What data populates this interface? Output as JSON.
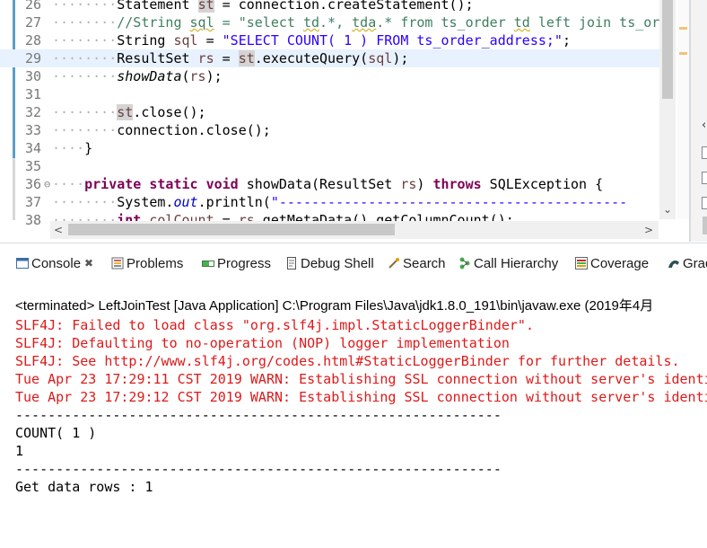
{
  "editor": {
    "lines": [
      {
        "num": "26",
        "fold": "",
        "indent": "········",
        "tokens": [
          {
            "t": "Statement "
          },
          {
            "t": "st",
            "c": "var occ"
          },
          {
            "t": " = connection.createStatement();"
          }
        ]
      },
      {
        "num": "27",
        "fold": "",
        "indent": "········",
        "tokens": [
          {
            "t": "//String ",
            "c": "cmt"
          },
          {
            "t": "sql",
            "c": "cmt squig"
          },
          {
            "t": " = \"select ",
            "c": "cmt"
          },
          {
            "t": "td",
            "c": "cmt squig"
          },
          {
            "t": ".*, ",
            "c": "cmt"
          },
          {
            "t": "tda",
            "c": "cmt squig"
          },
          {
            "t": ".* from ts_order ",
            "c": "cmt"
          },
          {
            "t": "td",
            "c": "cmt squig"
          },
          {
            "t": " left join ts_ord",
            "c": "cmt"
          }
        ]
      },
      {
        "num": "28",
        "fold": "",
        "indent": "········",
        "tokens": [
          {
            "t": "String "
          },
          {
            "t": "sql",
            "c": "var"
          },
          {
            "t": " = "
          },
          {
            "t": "\"SELECT COUNT( 1 ) FROM ts_order_address;\"",
            "c": "str"
          },
          {
            "t": ";"
          }
        ]
      },
      {
        "num": "29",
        "fold": "",
        "indent": "········",
        "current": true,
        "tokens": [
          {
            "t": "ResultSet "
          },
          {
            "t": "rs",
            "c": "var"
          },
          {
            "t": " = "
          },
          {
            "t": "st",
            "c": "var occ"
          },
          {
            "t": ".executeQuery("
          },
          {
            "t": "sql",
            "c": "var"
          },
          {
            "t": ");"
          }
        ]
      },
      {
        "num": "30",
        "fold": "",
        "indent": "········",
        "tokens": [
          {
            "t": "showData",
            "c": "it"
          },
          {
            "t": "("
          },
          {
            "t": "rs",
            "c": "var"
          },
          {
            "t": ");"
          }
        ]
      },
      {
        "num": "31",
        "fold": "",
        "indent": "",
        "tokens": []
      },
      {
        "num": "32",
        "fold": "",
        "indent": "········",
        "tokens": [
          {
            "t": "st",
            "c": "var occ"
          },
          {
            "t": ".close();"
          }
        ]
      },
      {
        "num": "33",
        "fold": "",
        "indent": "········",
        "tokens": [
          {
            "t": "connection.close();"
          }
        ]
      },
      {
        "num": "34",
        "fold": "",
        "indent": "····",
        "tokens": [
          {
            "t": "}"
          }
        ]
      },
      {
        "num": "35",
        "fold": "",
        "indent": "",
        "tokens": []
      },
      {
        "num": "36",
        "fold": "⊖",
        "indent": "····",
        "tokens": [
          {
            "t": "private static void",
            "c": "kw"
          },
          {
            "t": " showData(ResultSet "
          },
          {
            "t": "rs",
            "c": "var"
          },
          {
            "t": ") "
          },
          {
            "t": "throws",
            "c": "kw"
          },
          {
            "t": " SQLException {"
          }
        ]
      },
      {
        "num": "37",
        "fold": "",
        "indent": "········",
        "tokens": [
          {
            "t": "System."
          },
          {
            "t": "out",
            "c": "field"
          },
          {
            "t": ".println("
          },
          {
            "t": "\"-------------------------------------------",
            "c": "str"
          }
        ]
      },
      {
        "num": "38",
        "fold": "",
        "indent": "········",
        "tokens": [
          {
            "t": "int",
            "c": "kw"
          },
          {
            "t": " "
          },
          {
            "t": "colCount",
            "c": "var"
          },
          {
            "t": " = "
          },
          {
            "t": "rs",
            "c": "var"
          },
          {
            "t": ".getMetaData().getColumnCount();"
          }
        ]
      }
    ]
  },
  "tabs": [
    {
      "label": "Console",
      "icon": "console-icon",
      "active": true,
      "closable": true
    },
    {
      "label": "Problems",
      "icon": "problems-icon"
    },
    {
      "label": "Progress",
      "icon": "progress-icon"
    },
    {
      "label": "Debug Shell",
      "icon": "debug-shell-icon"
    },
    {
      "label": "Search",
      "icon": "search-icon"
    },
    {
      "label": "Call Hierarchy",
      "icon": "call-hierarchy-icon"
    },
    {
      "label": "Coverage",
      "icon": "coverage-icon"
    },
    {
      "label": "Grad",
      "icon": "gradle-icon"
    }
  ],
  "console": {
    "status": "<terminated> LeftJoinTest [Java Application] C:\\Program Files\\Java\\jdk1.8.0_191\\bin\\javaw.exe (2019年4月",
    "lines": [
      {
        "text": "SLF4J: Failed to load class \"org.slf4j.impl.StaticLoggerBinder\".",
        "type": "err"
      },
      {
        "text": "SLF4J: Defaulting to no-operation (NOP) logger implementation",
        "type": "err"
      },
      {
        "text": "SLF4J: See http://www.slf4j.org/codes.html#StaticLoggerBinder for further details.",
        "type": "err"
      },
      {
        "text": "Tue Apr 23 17:29:11 CST 2019 WARN: Establishing SSL connection without server's identi",
        "type": "err"
      },
      {
        "text": "Tue Apr 23 17:29:12 CST 2019 WARN: Establishing SSL connection without server's identi",
        "type": "err"
      },
      {
        "text": "------------------------------------------------------------",
        "type": "out"
      },
      {
        "text": "COUNT( 1 )",
        "type": "out"
      },
      {
        "text": "1",
        "type": "out"
      },
      {
        "text": "------------------------------------------------------------",
        "type": "out"
      },
      {
        "text": "Get data rows : 1",
        "type": "out"
      }
    ]
  },
  "colors": {
    "error": "#dd1a1a",
    "keyword": "#7f0055",
    "string": "#2a00ff",
    "comment": "#3f7f5f",
    "current_line": "#e8f2fe"
  }
}
